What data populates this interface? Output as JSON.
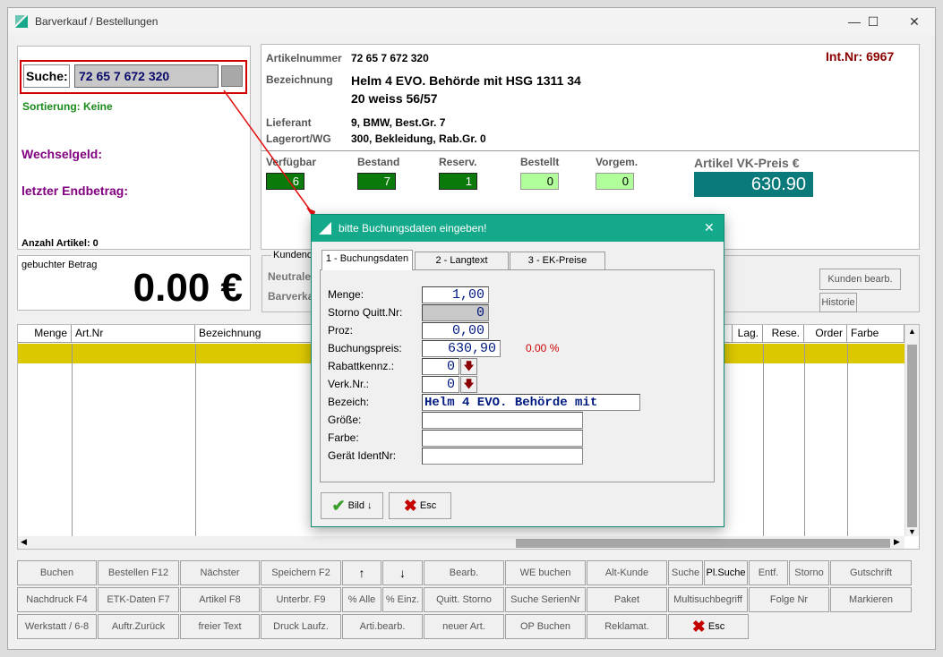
{
  "window": {
    "title": "Barverkauf / Bestellungen",
    "min": "—",
    "max": "☐",
    "close": "✕"
  },
  "left": {
    "search_label": "Suche:",
    "search_value": "72 65 7 672 320",
    "sort": "Sortierung: Keine",
    "change": "Wechselgeld:",
    "last_total": "letzter Endbetrag:",
    "article_count": "Anzahl Artikel: 0",
    "booked_label": "gebuchter Betrag",
    "booked_amount": "0.00 €"
  },
  "article": {
    "nr_label": "Artikelnummer",
    "nr": "72 65 7 672 320",
    "int_nr": "Int.Nr: 6967",
    "desc_label": "Bezeichnung",
    "desc1": "Helm 4 EVO. Behörde mit HSG 1311 34",
    "desc2": "20 weiss 56/57",
    "supplier_label": "Lieferant",
    "supplier": "9, BMW, Best.Gr. 7",
    "location_label": "Lagerort/WG",
    "location": "300, Bekleidung, Rab.Gr. 0",
    "stock_labels": [
      "Verfügbar",
      "Bestand",
      "Reserv.",
      "Bestellt",
      "Vorgem."
    ],
    "stock_values": [
      "6",
      "7",
      "1",
      "0",
      "0"
    ],
    "price_label": "Artikel VK-Preis €",
    "price": "630.90"
  },
  "customer": {
    "group": "Kundend",
    "row1": "Neutrale",
    "row2": "Barverka",
    "edit_button": "Kunden bearb.",
    "history_button": "Historie"
  },
  "table": {
    "headers": [
      "Menge",
      "Art.Nr",
      "Bezeichnung",
      "Lag.",
      "Rese.",
      "Order",
      "Farbe"
    ],
    "highlight_color": "#dcc800"
  },
  "buttons": {
    "row1": [
      "Buchen",
      "Bestellen F12",
      "Nächster",
      "Speichern F2",
      "↑",
      "↓",
      "Bearb.",
      "WE buchen",
      "Alt-Kunde",
      "Suche",
      "Pl.Suche",
      "Entf.",
      "Storno",
      "Gutschrift"
    ],
    "row2": [
      "Nachdruck F4",
      "ETK-Daten F7",
      "Artikel F8",
      "Unterbr. F9",
      "% Alle",
      "% Einz.",
      "Quitt. Storno",
      "Suche SerienNr",
      "Paket",
      "Multisuchbegriff",
      "Folge Nr",
      "Markieren"
    ],
    "row3": [
      "Werkstatt / 6-8",
      "Auftr.Zurück",
      "freier Text",
      "Druck Laufz.",
      "Arti.bearb.",
      "neuer Art.",
      "OP Buchen",
      "Reklamat.",
      "Esc"
    ]
  },
  "dialog": {
    "title": "bitte Buchungsdaten eingeben!",
    "close": "✕",
    "tabs": [
      "1 - Buchungsdaten",
      "2 - Langtext",
      "3 - EK-Preise"
    ],
    "labels": [
      "Menge:",
      "Storno Quitt.Nr:",
      "Proz:",
      "Buchungspreis:",
      "Rabattkennz.:",
      "Verk.Nr.:",
      "Bezeich:",
      "Größe:",
      "Farbe:",
      "Gerät IdentNr:"
    ],
    "menge": "1,00",
    "storno": "0",
    "proz": "0,00",
    "preis": "630,90",
    "percent": "0.00 %",
    "rabatt": "0",
    "verk": "0",
    "bezeich": "Helm 4 EVO. Behörde mit",
    "groesse": "",
    "farbe": "",
    "geraet": "",
    "bild_button": "Bild",
    "esc_button": "Esc"
  },
  "colors": {
    "accent": "#14a98a",
    "stock_dark": "#0a7a0a",
    "stock_light": "#b0ff9a",
    "price_box": "#0a7a7a",
    "int_nr": "#8b0000",
    "purple": "#800080",
    "green_text": "#1a8a1a"
  }
}
